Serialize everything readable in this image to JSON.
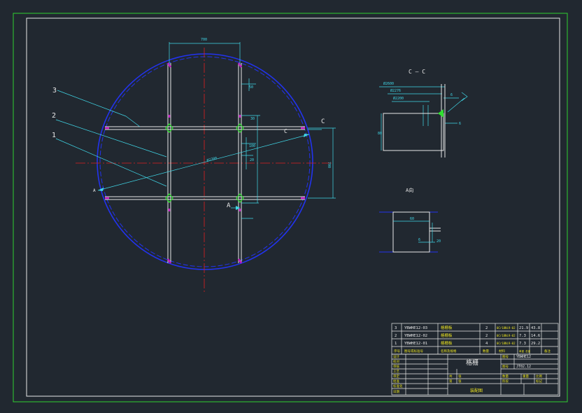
{
  "colors": {
    "background": "#212830",
    "frame": "#2fd02f",
    "border": "#e8e8e8",
    "shell": "#2233ee",
    "centerline": "#e02020",
    "dimension": "#40d8e8",
    "grid": "#e8e8e8",
    "weld": "#c018c0",
    "joint": "#30e030",
    "title_text": "#e8e8e8",
    "title_yellow": "#e8e020"
  },
  "plan_view": {
    "callouts": [
      "3",
      "2",
      "1"
    ],
    "dim_top": "700",
    "dim_right": "700",
    "dim_small_a": "50",
    "dim_small_b": "30",
    "dim_small_c": "100",
    "dim_small_d": "20",
    "dim_dia": "Ø2700",
    "section_mark": "C",
    "section_mark_c": "C",
    "view_a": "A",
    "view_a_lower": "A"
  },
  "section_cc": {
    "title": "C — C",
    "dim_1": "Ø2600",
    "dim_2": "Ø2276",
    "dim_3": "Ø2200",
    "dim_h": "80",
    "dim_t": "6",
    "weld_note": "6"
  },
  "view_a_detail": {
    "title": "A向",
    "dim_w": "60",
    "dim_h": "20",
    "dim_t": "6"
  },
  "parts_list": {
    "rows": [
      {
        "no": "3",
        "code": "YBWHE12-03",
        "name": "格栅板",
        "qty": "2",
        "material": "0Cr18Ni9-02",
        "unit": "21.9",
        "total": "43.8"
      },
      {
        "no": "2",
        "code": "YBWHE12-02",
        "name": "格栅板",
        "qty": "2",
        "material": "0Cr18Ni9-02",
        "unit": "7.3",
        "total": "14.6"
      },
      {
        "no": "1",
        "code": "YBWHE12-01",
        "name": "格栅板",
        "qty": "4",
        "material": "0Cr18Ni9-02",
        "unit": "7.3",
        "total": "29.2"
      }
    ],
    "header": {
      "no": "序号",
      "code": "图号或标准号",
      "name": "名称及规格",
      "qty": "数量",
      "material": "材料",
      "weight": "单重 总重",
      "note": "备注"
    }
  },
  "title_block": {
    "left_labels": [
      "设计",
      "校对",
      "审核",
      "工艺",
      "审定",
      "批准",
      "标准化",
      "日期"
    ],
    "part_name": "格栅",
    "sheet_code_label": "图号",
    "sheet_code": "YBWHE12",
    "drawing_no_label": "图号",
    "drawing_no": "JT02.12",
    "row_labels": [
      "共",
      "张",
      "第",
      "张"
    ],
    "scale_row": [
      "数量",
      "重量",
      "比例"
    ],
    "stage_labels": [
      "阶段",
      "标记"
    ],
    "company": "装配图"
  }
}
